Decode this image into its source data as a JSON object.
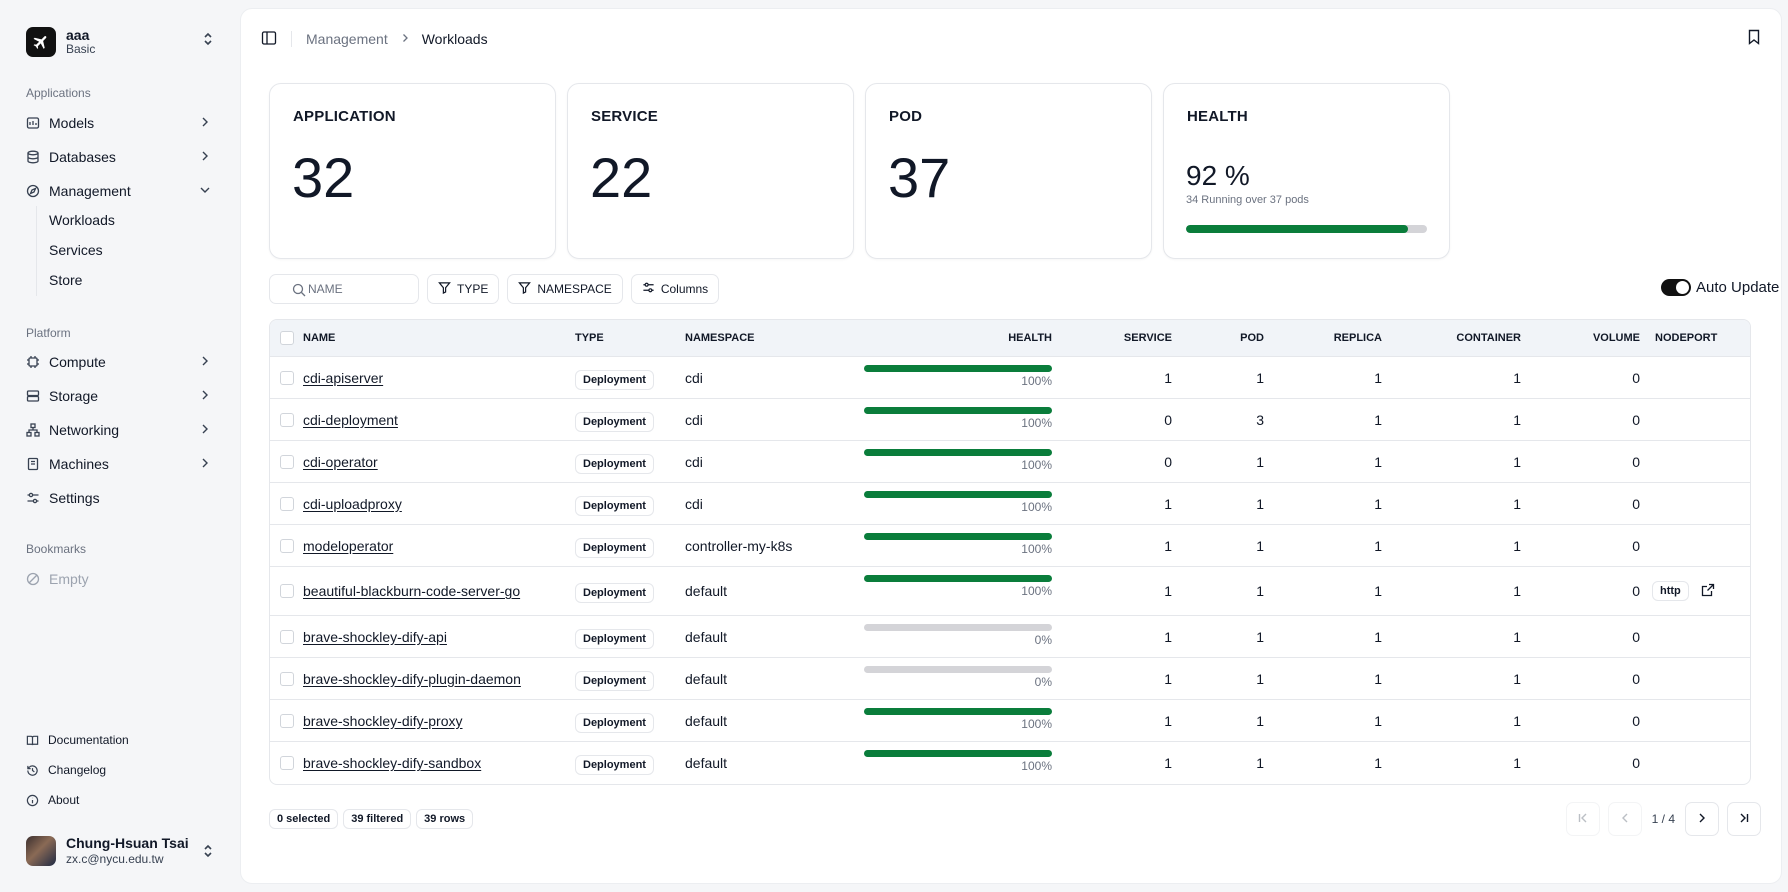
{
  "org": {
    "name": "aaa",
    "plan": "Basic"
  },
  "sidebar": {
    "applications_label": "Applications",
    "applications": [
      {
        "label": "Models",
        "icon": "models-icon"
      },
      {
        "label": "Databases",
        "icon": "database-icon"
      },
      {
        "label": "Management",
        "icon": "compass-icon",
        "expanded": true
      }
    ],
    "management_sub": [
      "Workloads",
      "Services",
      "Store"
    ],
    "platform_label": "Platform",
    "platform": [
      {
        "label": "Compute",
        "icon": "cpu-icon"
      },
      {
        "label": "Storage",
        "icon": "storage-icon"
      },
      {
        "label": "Networking",
        "icon": "network-icon"
      },
      {
        "label": "Machines",
        "icon": "machine-icon"
      },
      {
        "label": "Settings",
        "icon": "settings-icon"
      }
    ],
    "bookmarks_label": "Bookmarks",
    "bookmarks_empty": "Empty",
    "footer_links": [
      {
        "label": "Documentation",
        "icon": "book-icon"
      },
      {
        "label": "Changelog",
        "icon": "history-icon"
      },
      {
        "label": "About",
        "icon": "info-icon"
      }
    ]
  },
  "user": {
    "name": "Chung-Hsuan Tsai",
    "email": "zx.c@nycu.edu.tw"
  },
  "breadcrumb": {
    "parent": "Management",
    "current": "Workloads"
  },
  "cards": {
    "application": {
      "title": "APPLICATION",
      "value": "32"
    },
    "service": {
      "title": "SERVICE",
      "value": "22"
    },
    "pod": {
      "title": "POD",
      "value": "37"
    },
    "health": {
      "title": "HEALTH",
      "value": "92 %",
      "subtitle": "34 Running over 37 pods",
      "fraction": 0.92
    }
  },
  "toolbar": {
    "search_placeholder": "NAME",
    "type_label": "TYPE",
    "namespace_label": "NAMESPACE",
    "columns_label": "Columns",
    "auto_update_label": "Auto Update",
    "auto_update_on": true
  },
  "table": {
    "headers": {
      "name": "NAME",
      "type": "TYPE",
      "namespace": "NAMESPACE",
      "health": "HEALTH",
      "service": "SERVICE",
      "pod": "POD",
      "replica": "REPLICA",
      "container": "CONTAINER",
      "volume": "VOLUME",
      "nodeport": "NODEPORT"
    },
    "rows": [
      {
        "name": "cdi-apiserver",
        "type": "Deployment",
        "namespace": "cdi",
        "health": 100,
        "health_label": "100%",
        "service": "1",
        "pod": "1",
        "replica": "1",
        "container": "1",
        "volume": "0",
        "nodeport": ""
      },
      {
        "name": "cdi-deployment",
        "type": "Deployment",
        "namespace": "cdi",
        "health": 100,
        "health_label": "100%",
        "service": "0",
        "pod": "3",
        "replica": "1",
        "container": "1",
        "volume": "0",
        "nodeport": ""
      },
      {
        "name": "cdi-operator",
        "type": "Deployment",
        "namespace": "cdi",
        "health": 100,
        "health_label": "100%",
        "service": "0",
        "pod": "1",
        "replica": "1",
        "container": "1",
        "volume": "0",
        "nodeport": ""
      },
      {
        "name": "cdi-uploadproxy",
        "type": "Deployment",
        "namespace": "cdi",
        "health": 100,
        "health_label": "100%",
        "service": "1",
        "pod": "1",
        "replica": "1",
        "container": "1",
        "volume": "0",
        "nodeport": ""
      },
      {
        "name": "modeloperator",
        "type": "Deployment",
        "namespace": "controller-my-k8s",
        "health": 100,
        "health_label": "100%",
        "service": "1",
        "pod": "1",
        "replica": "1",
        "container": "1",
        "volume": "0",
        "nodeport": ""
      },
      {
        "name": "beautiful-blackburn-code-server-go",
        "type": "Deployment",
        "namespace": "default",
        "health": 100,
        "health_label": "100%",
        "service": "1",
        "pod": "1",
        "replica": "1",
        "container": "1",
        "volume": "0",
        "nodeport": "http"
      },
      {
        "name": "brave-shockley-dify-api",
        "type": "Deployment",
        "namespace": "default",
        "health": 0,
        "health_label": "0%",
        "service": "1",
        "pod": "1",
        "replica": "1",
        "container": "1",
        "volume": "0",
        "nodeport": ""
      },
      {
        "name": "brave-shockley-dify-plugin-daemon",
        "type": "Deployment",
        "namespace": "default",
        "health": 0,
        "health_label": "0%",
        "service": "1",
        "pod": "1",
        "replica": "1",
        "container": "1",
        "volume": "0",
        "nodeport": ""
      },
      {
        "name": "brave-shockley-dify-proxy",
        "type": "Deployment",
        "namespace": "default",
        "health": 100,
        "health_label": "100%",
        "service": "1",
        "pod": "1",
        "replica": "1",
        "container": "1",
        "volume": "0",
        "nodeport": ""
      },
      {
        "name": "brave-shockley-dify-sandbox",
        "type": "Deployment",
        "namespace": "default",
        "health": 100,
        "health_label": "100%",
        "service": "1",
        "pod": "1",
        "replica": "1",
        "container": "1",
        "volume": "0",
        "nodeport": ""
      }
    ]
  },
  "footer": {
    "selected": "0 selected",
    "filtered": "39 filtered",
    "rows": "39 rows",
    "page_info": "1 / 4"
  },
  "colors": {
    "accent": "#0a7d3b",
    "empty_bar": "#d4d4d8"
  }
}
